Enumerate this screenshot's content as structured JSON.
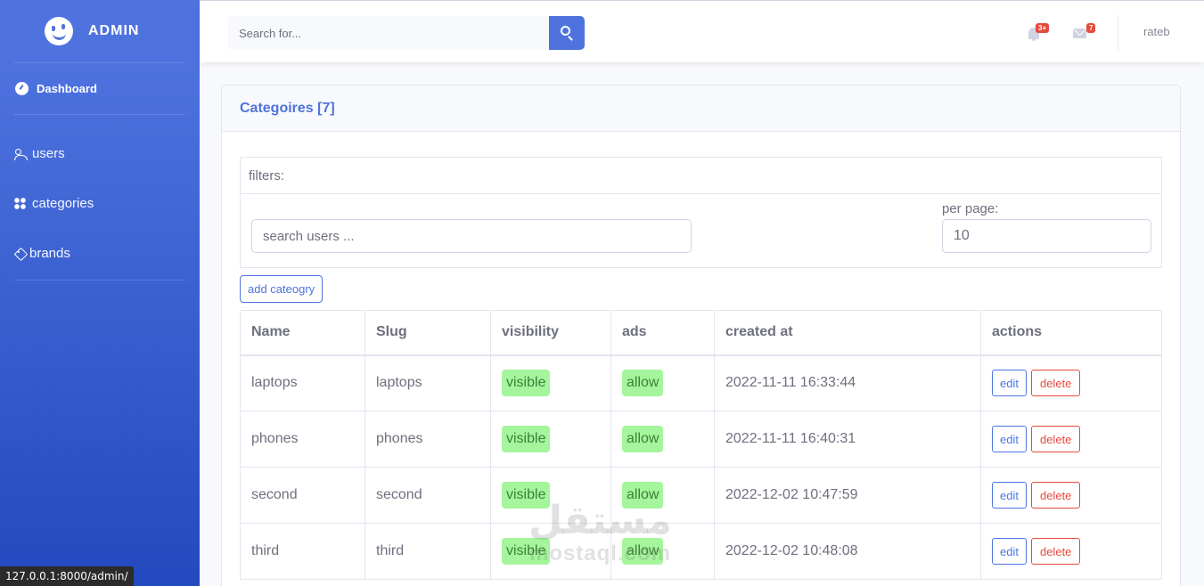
{
  "sidebar": {
    "brand": "ADMIN",
    "dashboard": "Dashboard",
    "items": [
      {
        "label": "users",
        "icon": "users-icon"
      },
      {
        "label": "categories",
        "icon": "categories-icon"
      },
      {
        "label": "brands",
        "icon": "tag-icon"
      }
    ]
  },
  "topbar": {
    "search_placeholder": "Search for...",
    "alerts_badge": "3+",
    "messages_badge": "7",
    "user": "rateb"
  },
  "card": {
    "title": "Categoires [7]",
    "filters_label": "filters:",
    "search_placeholder": "search users ...",
    "per_page_label": "per page:",
    "per_page_value": "10",
    "add_button": "add cateogry"
  },
  "table": {
    "headers": [
      "Name",
      "Slug",
      "visibility",
      "ads",
      "created at",
      "actions"
    ],
    "rows": [
      {
        "name": "laptops",
        "slug": "laptops",
        "visibility": "visible",
        "ads": "allow",
        "created_at": "2022-11-11 16:33:44"
      },
      {
        "name": "phones",
        "slug": "phones",
        "visibility": "visible",
        "ads": "allow",
        "created_at": "2022-11-11 16:40:31"
      },
      {
        "name": "second",
        "slug": "second",
        "visibility": "visible",
        "ads": "allow",
        "created_at": "2022-12-02 10:47:59"
      },
      {
        "name": "third",
        "slug": "third",
        "visibility": "visible",
        "ads": "allow",
        "created_at": "2022-12-02 10:48:08"
      }
    ],
    "edit_label": "edit",
    "delete_label": "delete"
  },
  "status_url": "127.0.0.1:8000/admin/",
  "watermark": {
    "arabic": "مستقل",
    "latin": "mostaql.com"
  },
  "colors": {
    "primary": "#4e73df",
    "danger": "#e74a3b",
    "pill": "#a4f59b"
  }
}
